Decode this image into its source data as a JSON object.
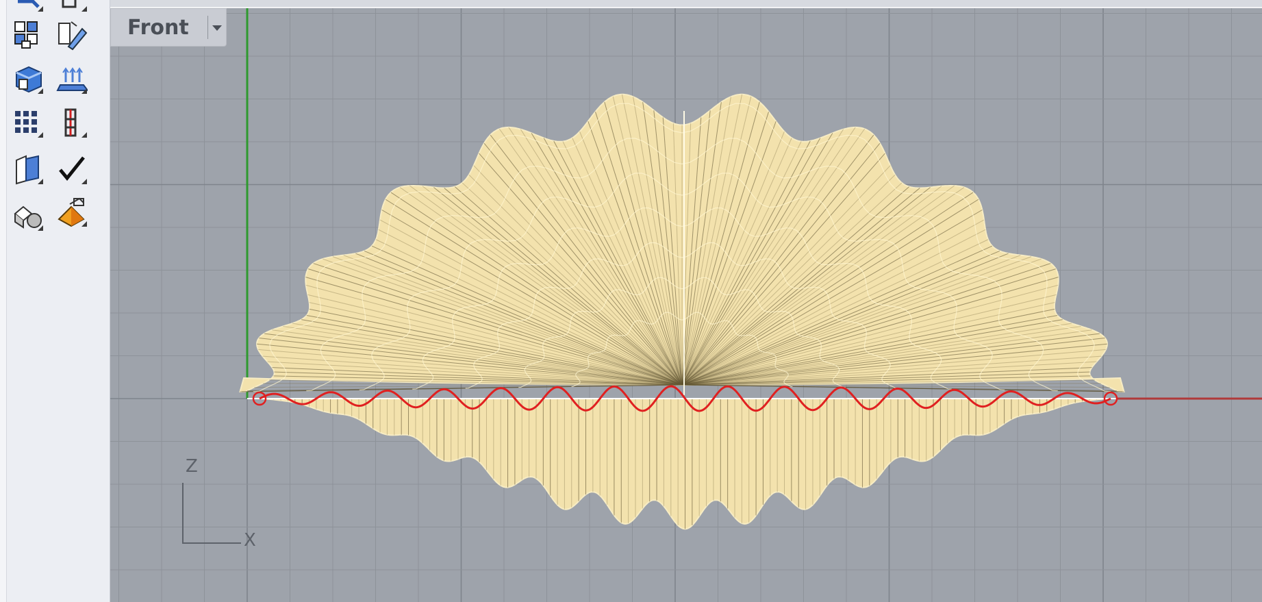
{
  "viewport": {
    "title": "Front",
    "axis_labels": {
      "vertical": "Z",
      "horizontal": "X"
    }
  },
  "toolbar": {
    "tools": [
      "group-icon",
      "edit-point-icon",
      "solid-box-icon",
      "planar-array-icon",
      "grid-array-icon",
      "dimension-icon",
      "box-edit-icon",
      "check-icon",
      "primitives-icon",
      "render-material-icon"
    ]
  },
  "colors": {
    "viewport_bg": "#9ea3ab",
    "grid_line": "#8d9299",
    "grid_major": "#7f848c",
    "surface": "#f3e2ad",
    "surface_line": "#7a6f4f",
    "curve": "#e02020",
    "x_axis": "#b03a3a",
    "z_axis": "#2e9a2e"
  }
}
